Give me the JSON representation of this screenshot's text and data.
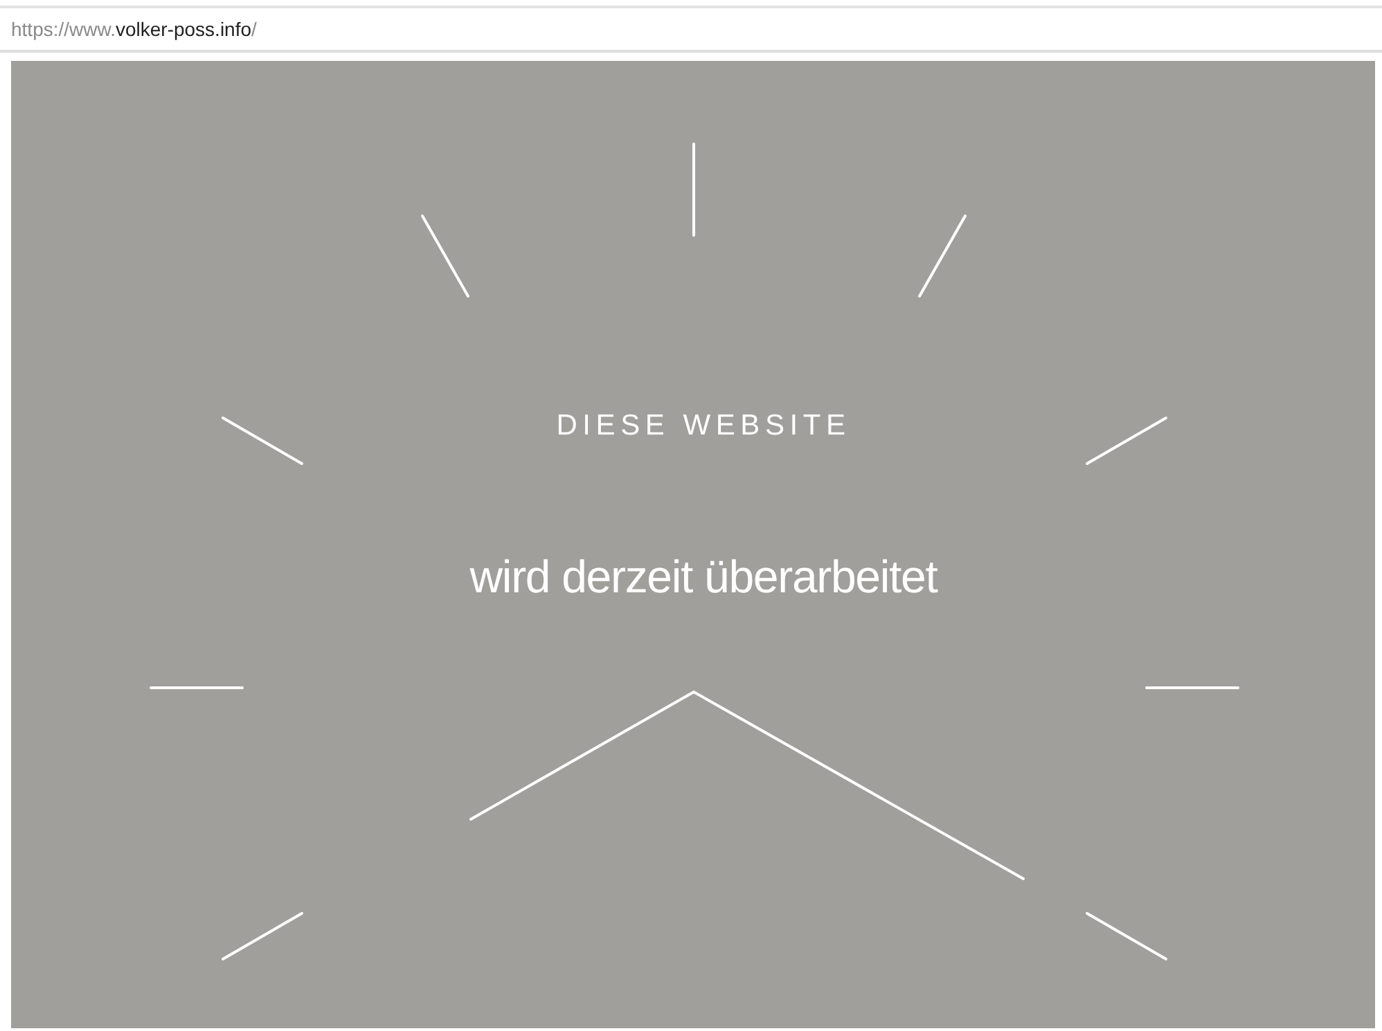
{
  "address_bar": {
    "scheme": "https://www.",
    "host": "volker-poss.info",
    "path": "/"
  },
  "page": {
    "heading": "DIESE WEBSITE",
    "subheading": "wird derzeit überarbeitet"
  }
}
